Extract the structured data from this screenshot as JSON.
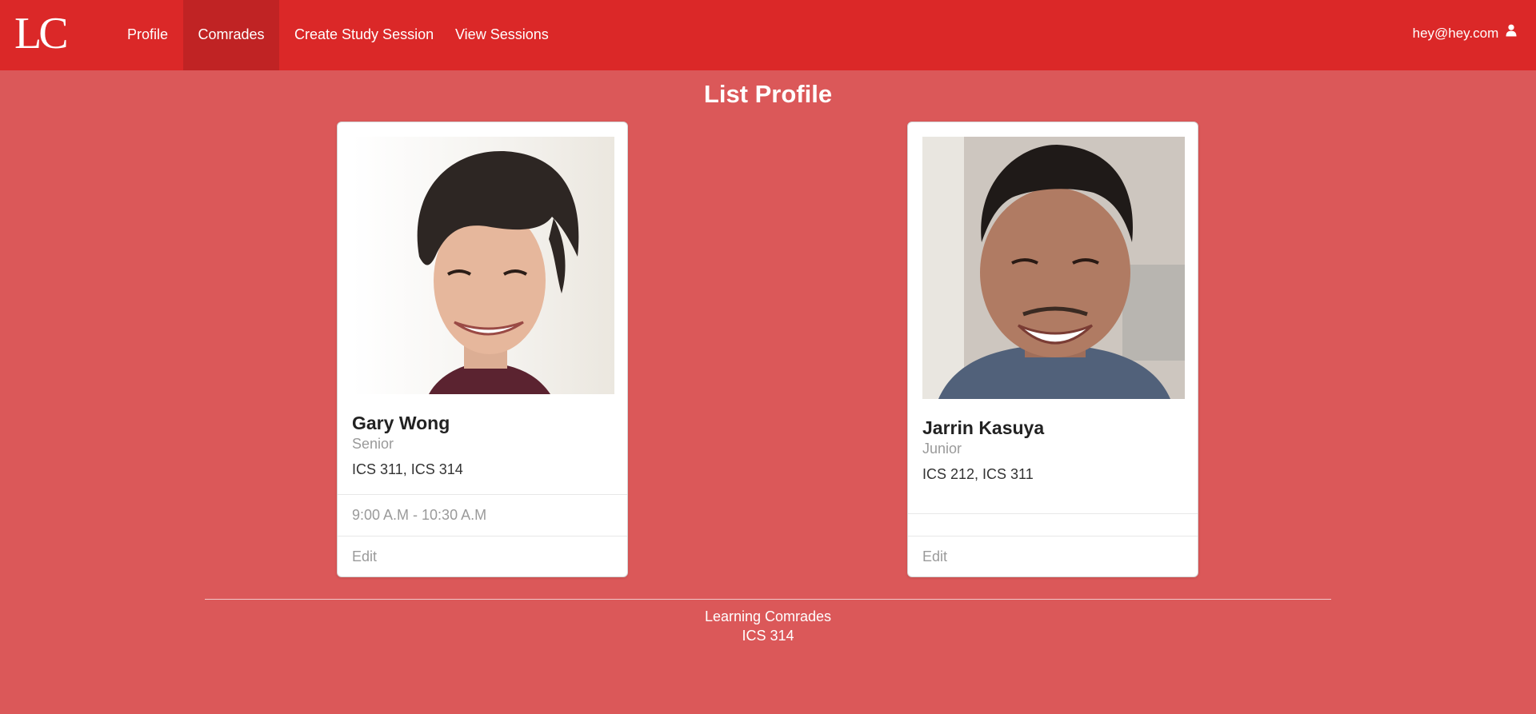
{
  "nav": {
    "logo": "LC",
    "items": [
      {
        "label": "Profile"
      },
      {
        "label": "Comrades"
      },
      {
        "label": "Create Study Session"
      },
      {
        "label": "View Sessions"
      }
    ],
    "active_index": 1,
    "user_email": "hey@hey.com",
    "user_icon": "user-icon"
  },
  "page": {
    "title": "List Profile"
  },
  "profiles": [
    {
      "name": "Gary Wong",
      "year": "Senior",
      "courses": "ICS 311, ICS 314",
      "time": "9:00 A.M - 10:30 A.M",
      "edit_label": "Edit"
    },
    {
      "name": "Jarrin Kasuya",
      "year": "Junior",
      "courses": "ICS 212, ICS 311",
      "time": "",
      "edit_label": "Edit"
    }
  ],
  "footer": {
    "line1": "Learning Comrades",
    "line2": "ICS 314"
  },
  "colors": {
    "nav_bg": "#db2828",
    "nav_active": "#c02324",
    "page_bg": "#db5859"
  }
}
